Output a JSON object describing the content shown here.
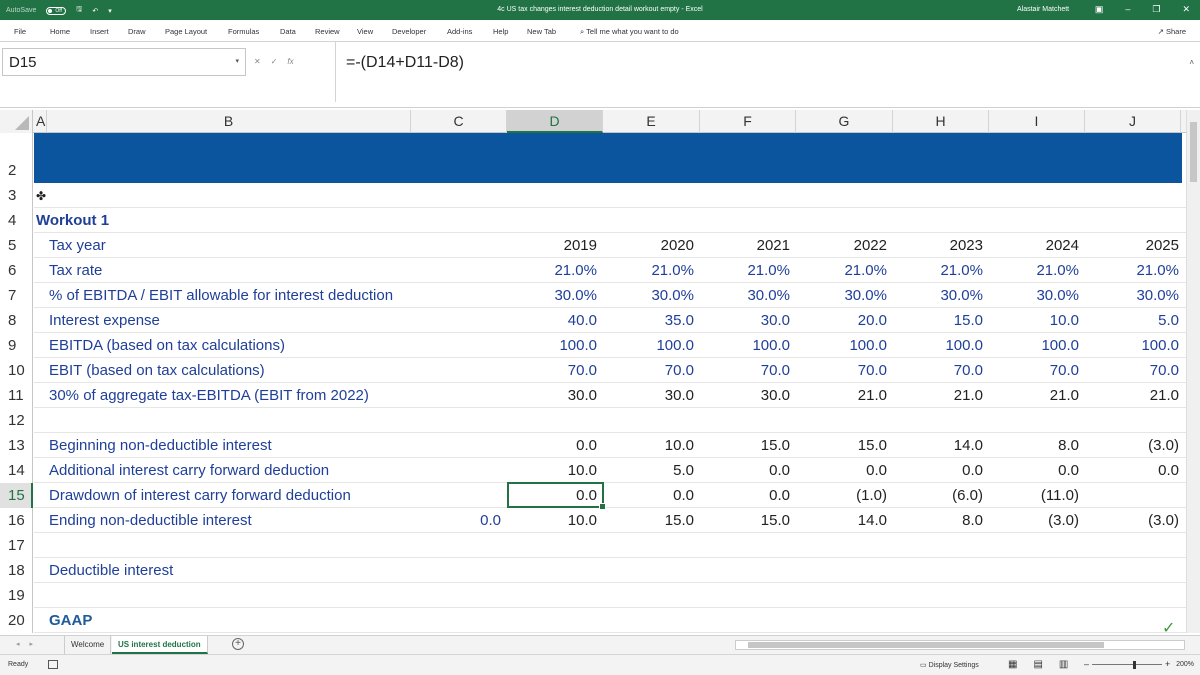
{
  "titlebar": {
    "autosave": "AutoSave",
    "autosave_state": "Off",
    "title": "4c US tax changes interest deduction detail workout empty  -  Excel",
    "user": "Alastair Matchett"
  },
  "ribbon": {
    "tabs": [
      "File",
      "Home",
      "Insert",
      "Draw",
      "Page Layout",
      "Formulas",
      "Data",
      "Review",
      "View",
      "Developer",
      "Add-ins",
      "Help",
      "New Tab"
    ],
    "tell_me": "Tell me what you want to do",
    "share": "Share"
  },
  "formula_bar": {
    "name_box": "D15",
    "formula": "=-(D14+D11-D8)"
  },
  "columns": [
    "A",
    "B",
    "C",
    "D",
    "E",
    "F",
    "G",
    "H",
    "I",
    "J"
  ],
  "rows": {
    "r2": "2",
    "r3": "3",
    "r4": {
      "num": "4",
      "label": "Workout 1"
    },
    "r5": {
      "num": "5",
      "label": "Tax year",
      "values": [
        "2019",
        "2020",
        "2021",
        "2022",
        "2023",
        "2024",
        "2025"
      ]
    },
    "r6": {
      "num": "6",
      "label": "Tax rate",
      "values": [
        "21.0%",
        "21.0%",
        "21.0%",
        "21.0%",
        "21.0%",
        "21.0%",
        "21.0%"
      ]
    },
    "r7": {
      "num": "7",
      "label": "% of EBITDA / EBIT allowable for interest deduction",
      "values": [
        "30.0%",
        "30.0%",
        "30.0%",
        "30.0%",
        "30.0%",
        "30.0%",
        "30.0%"
      ]
    },
    "r8": {
      "num": "8",
      "label": "Interest expense",
      "values": [
        "40.0",
        "35.0",
        "30.0",
        "20.0",
        "15.0",
        "10.0",
        "5.0"
      ]
    },
    "r9": {
      "num": "9",
      "label": "EBITDA (based on tax calculations)",
      "values": [
        "100.0",
        "100.0",
        "100.0",
        "100.0",
        "100.0",
        "100.0",
        "100.0"
      ]
    },
    "r10": {
      "num": "10",
      "label": "EBIT (based on tax calculations)",
      "values": [
        "70.0",
        "70.0",
        "70.0",
        "70.0",
        "70.0",
        "70.0",
        "70.0"
      ]
    },
    "r11": {
      "num": "11",
      "label": "30% of aggregate tax-EBITDA (EBIT from 2022)",
      "values": [
        "30.0",
        "30.0",
        "30.0",
        "21.0",
        "21.0",
        "21.0",
        "21.0"
      ]
    },
    "r12": {
      "num": "12"
    },
    "r13": {
      "num": "13",
      "label": "Beginning non-deductible interest",
      "values": [
        "0.0",
        "10.0",
        "15.0",
        "15.0",
        "14.0",
        "8.0",
        "(3.0)"
      ]
    },
    "r14": {
      "num": "14",
      "label": "Additional interest carry forward deduction",
      "values": [
        "10.0",
        "5.0",
        "0.0",
        "0.0",
        "0.0",
        "0.0",
        "0.0"
      ]
    },
    "r15": {
      "num": "15",
      "label": "Drawdown of interest carry forward deduction",
      "values": [
        "0.0",
        "0.0",
        "0.0",
        "(1.0)",
        "(6.0)",
        "(11.0)",
        ""
      ]
    },
    "r16": {
      "num": "16",
      "label": "Ending non-deductible interest",
      "c_value": "0.0",
      "values": [
        "10.0",
        "15.0",
        "15.0",
        "14.0",
        "8.0",
        "(3.0)",
        "(3.0)"
      ]
    },
    "r17": {
      "num": "17"
    },
    "r18": {
      "num": "18",
      "label": "Deductible interest"
    },
    "r19": {
      "num": "19"
    },
    "r20": {
      "num": "20",
      "label": "GAAP"
    }
  },
  "sheets": [
    "Welcome",
    "US interest deduction"
  ],
  "status": {
    "ready": "Ready",
    "display_settings": "Display Settings",
    "zoom": "200%"
  }
}
